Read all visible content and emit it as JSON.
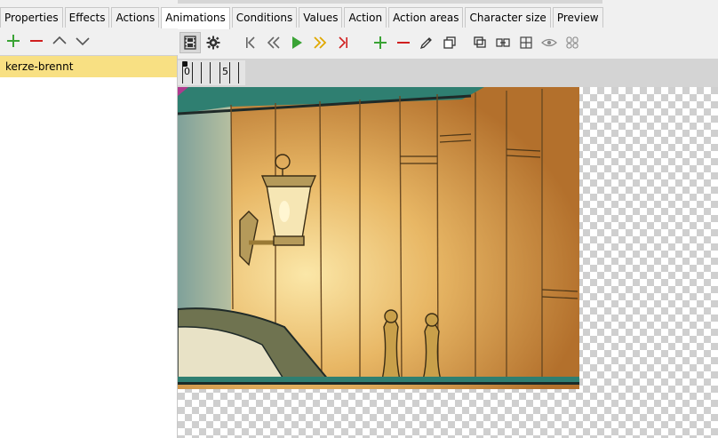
{
  "tabs": [
    {
      "label": "Properties"
    },
    {
      "label": "Effects"
    },
    {
      "label": "Actions"
    },
    {
      "label": "Animations"
    },
    {
      "label": "Conditions"
    },
    {
      "label": "Values"
    },
    {
      "label": "Action"
    },
    {
      "label": "Action areas"
    },
    {
      "label": "Character size"
    },
    {
      "label": "Preview"
    }
  ],
  "active_tab": "Animations",
  "animations": {
    "items": [
      {
        "label": "kerze-brennt",
        "selected": true
      }
    ]
  },
  "timeline": {
    "labels": [
      "0",
      "5"
    ]
  },
  "colors": {
    "selection": "#f8e083",
    "add": "#3aa335",
    "remove": "#d01f1f",
    "play": "#3aa335",
    "fast_forward": "#e0a800",
    "to_end": "#d01f1f"
  },
  "icons": {
    "left_toolbar": [
      "add-icon",
      "remove-icon",
      "move-up-icon",
      "move-down-icon"
    ],
    "right_toolbar": [
      "film-icon",
      "gear-icon",
      "go-to-start-icon",
      "rewind-icon",
      "play-icon",
      "fast-forward-icon",
      "go-to-end-icon",
      "add-frame-icon",
      "remove-frame-icon",
      "edit-icon",
      "copy-icon",
      "layers-icon",
      "link-frames-icon",
      "grid-icon",
      "eye-icon",
      "onion-skin-icon"
    ]
  }
}
